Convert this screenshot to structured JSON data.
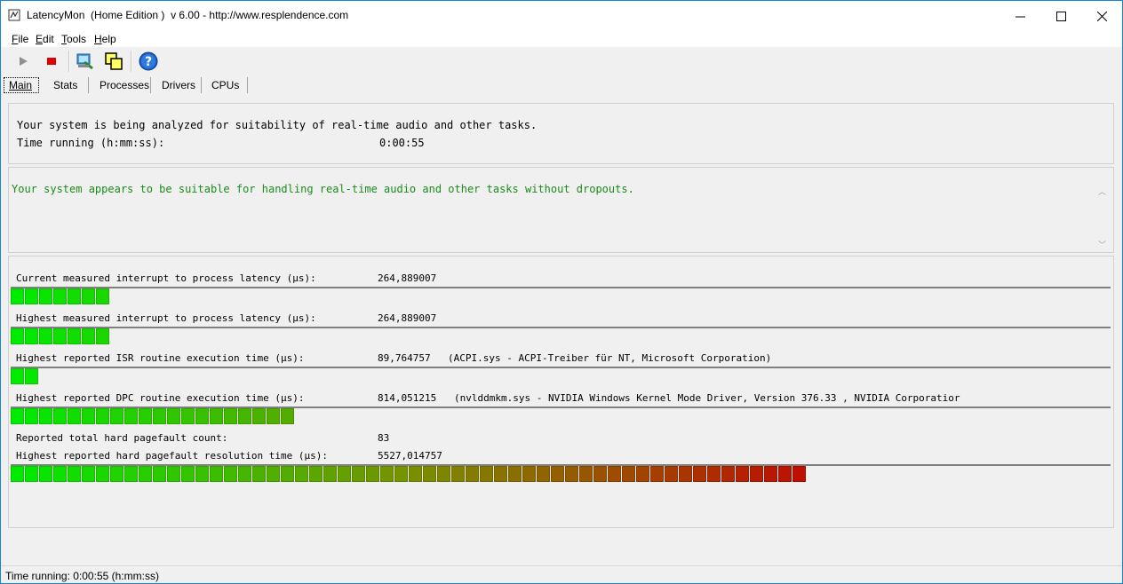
{
  "window": {
    "title": "LatencyMon  (Home Edition )  v 6.00 - http://www.resplendence.com"
  },
  "menu": [
    {
      "label": "File",
      "accel": "F",
      "rest": "ile"
    },
    {
      "label": "Edit",
      "accel": "E",
      "rest": "dit"
    },
    {
      "label": "Tools",
      "accel": "T",
      "rest": "ools"
    },
    {
      "label": "Help",
      "accel": "H",
      "rest": "elp"
    }
  ],
  "toolbar": {
    "icons": [
      "play-icon",
      "stop-icon",
      "analyze-icon",
      "copy-windows-icon",
      "help-icon"
    ]
  },
  "tabs": [
    {
      "label": "Main",
      "active": true
    },
    {
      "label": "Stats"
    },
    {
      "label": "Processes"
    },
    {
      "label": "Drivers"
    },
    {
      "label": "CPUs"
    }
  ],
  "summary": {
    "line1": "Your system is being analyzed for suitability of real-time audio and other tasks.",
    "time_label": "Time running (h:mm:ss):",
    "time_value": "0:00:55"
  },
  "verdict": {
    "text": "Your system appears to be suitable for handling real-time audio and other tasks without dropouts.",
    "color": "#1a8c1a"
  },
  "metrics": [
    {
      "label": "Current measured interrupt to process latency (µs):",
      "value": "264,889007",
      "detail": "",
      "bar_segments": 7
    },
    {
      "label": "Highest measured interrupt to process latency (µs):",
      "value": "264,889007",
      "detail": "",
      "bar_segments": 7
    },
    {
      "label": "Highest reported ISR routine execution time (µs):",
      "value": "89,764757",
      "detail": "(ACPI.sys - ACPI-Treiber für NT, Microsoft Corporation)",
      "bar_segments": 2
    },
    {
      "label": "Highest reported DPC routine execution time (µs):",
      "value": "814,051215",
      "detail": "(nvlddmkm.sys - NVIDIA Windows Kernel Mode Driver, Version 376.33 , NVIDIA Corporatior",
      "bar_segments": 20
    },
    {
      "label": "Reported total hard pagefault count:",
      "value": "83",
      "detail": ""
    },
    {
      "label": "Highest reported hard pagefault resolution time (µs):",
      "value": "5527,014757",
      "detail": "",
      "bar_segments": 56
    }
  ],
  "status": {
    "text": "Time running: 0:00:55  (h:mm:ss)"
  }
}
